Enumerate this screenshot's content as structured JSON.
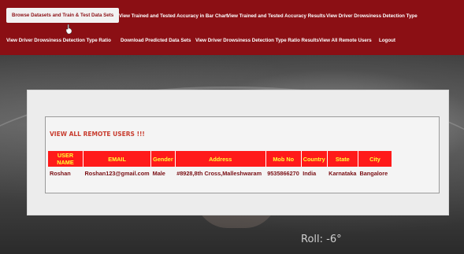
{
  "nav": {
    "row1": [
      {
        "label": "Browse Datasets and Train & Test Data Sets",
        "active": true
      },
      {
        "label": "View Trained and Tested Accuracy in Bar Chart"
      },
      {
        "label": "View Trained and Tested Accuracy Results"
      },
      {
        "label": "View Driver Drowsiness Detection Type"
      }
    ],
    "row2": [
      {
        "label": "View Driver Drowsiness Detection Type Ratio"
      },
      {
        "label": "Download Predicted Data Sets"
      },
      {
        "label": "View Driver Drowsiness Detection Type Ratio Results"
      },
      {
        "label": "View All Remote Users"
      },
      {
        "label": "Logout"
      }
    ]
  },
  "main": {
    "heading": "VIEW ALL REMOTE USERS !!!",
    "table": {
      "columns": [
        "USER NAME",
        "EMAIL",
        "Gender",
        "Address",
        "Mob No",
        "Country",
        "State",
        "City"
      ],
      "rows": [
        [
          "Roshan",
          "Roshan123@gmail.com",
          "Male",
          "#8928,8th Cross,Malleshwaram",
          "9535866270",
          "India",
          "Karnataka",
          "Bangalore"
        ]
      ]
    }
  },
  "background_overlay_text": "Roll: -6°",
  "colors": {
    "nav_bg": "#8b0f14",
    "header_bg": "#ff1a1a",
    "header_text": "#ffff33",
    "cell_text": "#7a0f14",
    "heading_text": "#c83c2e"
  }
}
